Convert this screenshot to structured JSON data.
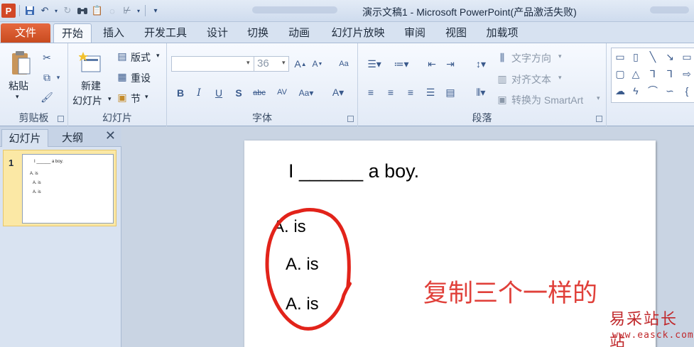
{
  "title_bar": {
    "title": "演示文稿1 - Microsoft PowerPoint(产品激活失败)"
  },
  "tabs": [
    "文件",
    "开始",
    "插入",
    "开发工具",
    "设计",
    "切换",
    "动画",
    "幻灯片放映",
    "审阅",
    "视图",
    "加载项"
  ],
  "ribbon": {
    "clipboard": {
      "paste": "粘贴",
      "label": "剪贴板"
    },
    "slides": {
      "new_slide_1": "新建",
      "new_slide_2": "幻灯片",
      "layout": "版式",
      "reset": "重设",
      "section": "节",
      "label": "幻灯片"
    },
    "font": {
      "size": "36",
      "label": "字体"
    },
    "paragraph": {
      "text_direction": "文字方向",
      "align_text": "对齐文本",
      "smartart": "转换为 SmartArt",
      "label": "段落"
    }
  },
  "left_pane": {
    "tab_slides": "幻灯片",
    "tab_outline": "大纲",
    "close": "✕",
    "slide_number": "1",
    "thumb_title": "I ______ a boy.",
    "thumb_lines": [
      "A. is",
      "A. is",
      "A. is"
    ]
  },
  "slide": {
    "title": "I  ______  a boy.",
    "options": [
      "A.  is",
      "A.  is",
      "A.  is"
    ],
    "annotation": "复制三个一样的",
    "annotation_color": "#e0403a"
  },
  "watermark": {
    "name": "易采站长站",
    "url": "www.easck.com"
  }
}
